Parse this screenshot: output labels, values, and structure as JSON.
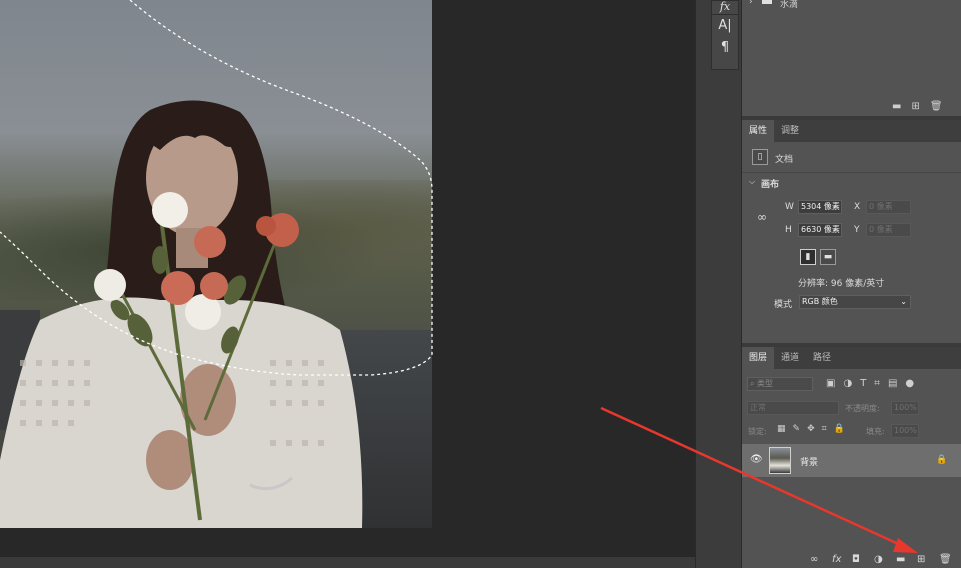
{
  "app": {
    "theme_colors": {
      "panel": "#535353",
      "canvas": "#282828",
      "accent_arrow": "#e8372c"
    }
  },
  "canvas": {
    "selection": "marching-ants lasso selection",
    "figure": "woman holding bouquet of roses"
  },
  "tool_column": {
    "fx_label": "fx",
    "char_icon": "A|",
    "para_icon": "¶"
  },
  "layer_group_top": {
    "name": "水滴",
    "chevron": "›"
  },
  "top_toolbar_icons": [
    "folder-icon",
    "new-icon",
    "trash-icon"
  ],
  "properties_panel": {
    "tabs": [
      "属性",
      "调整"
    ],
    "doc_label": "文档",
    "canvas_section": "画布",
    "width_label": "W",
    "width_value": "5304 像素",
    "height_label": "H",
    "height_value": "6630 像素",
    "x_label": "X",
    "x_value": "0 像素",
    "y_label": "Y",
    "y_value": "0 像素",
    "resolution": "分辨率: 96 像素/英寸",
    "mode_label": "模式",
    "mode_value": "RGB 颜色"
  },
  "layers_panel": {
    "tabs": [
      "图层",
      "通道",
      "路径"
    ],
    "filter_placeholder": "类型",
    "blend_mode": "正常",
    "opacity_label": "不透明度:",
    "opacity_value": "100%",
    "lock_label": "锁定:",
    "fill_label": "填充:",
    "fill_value": "100%",
    "layers": [
      {
        "name": "背景",
        "visible": true,
        "locked": true
      }
    ],
    "bottom_icons": [
      "link-icon",
      "fx-icon",
      "mask-icon",
      "adjustment-icon",
      "group-folder-icon",
      "new-layer-icon",
      "delete-icon"
    ]
  }
}
